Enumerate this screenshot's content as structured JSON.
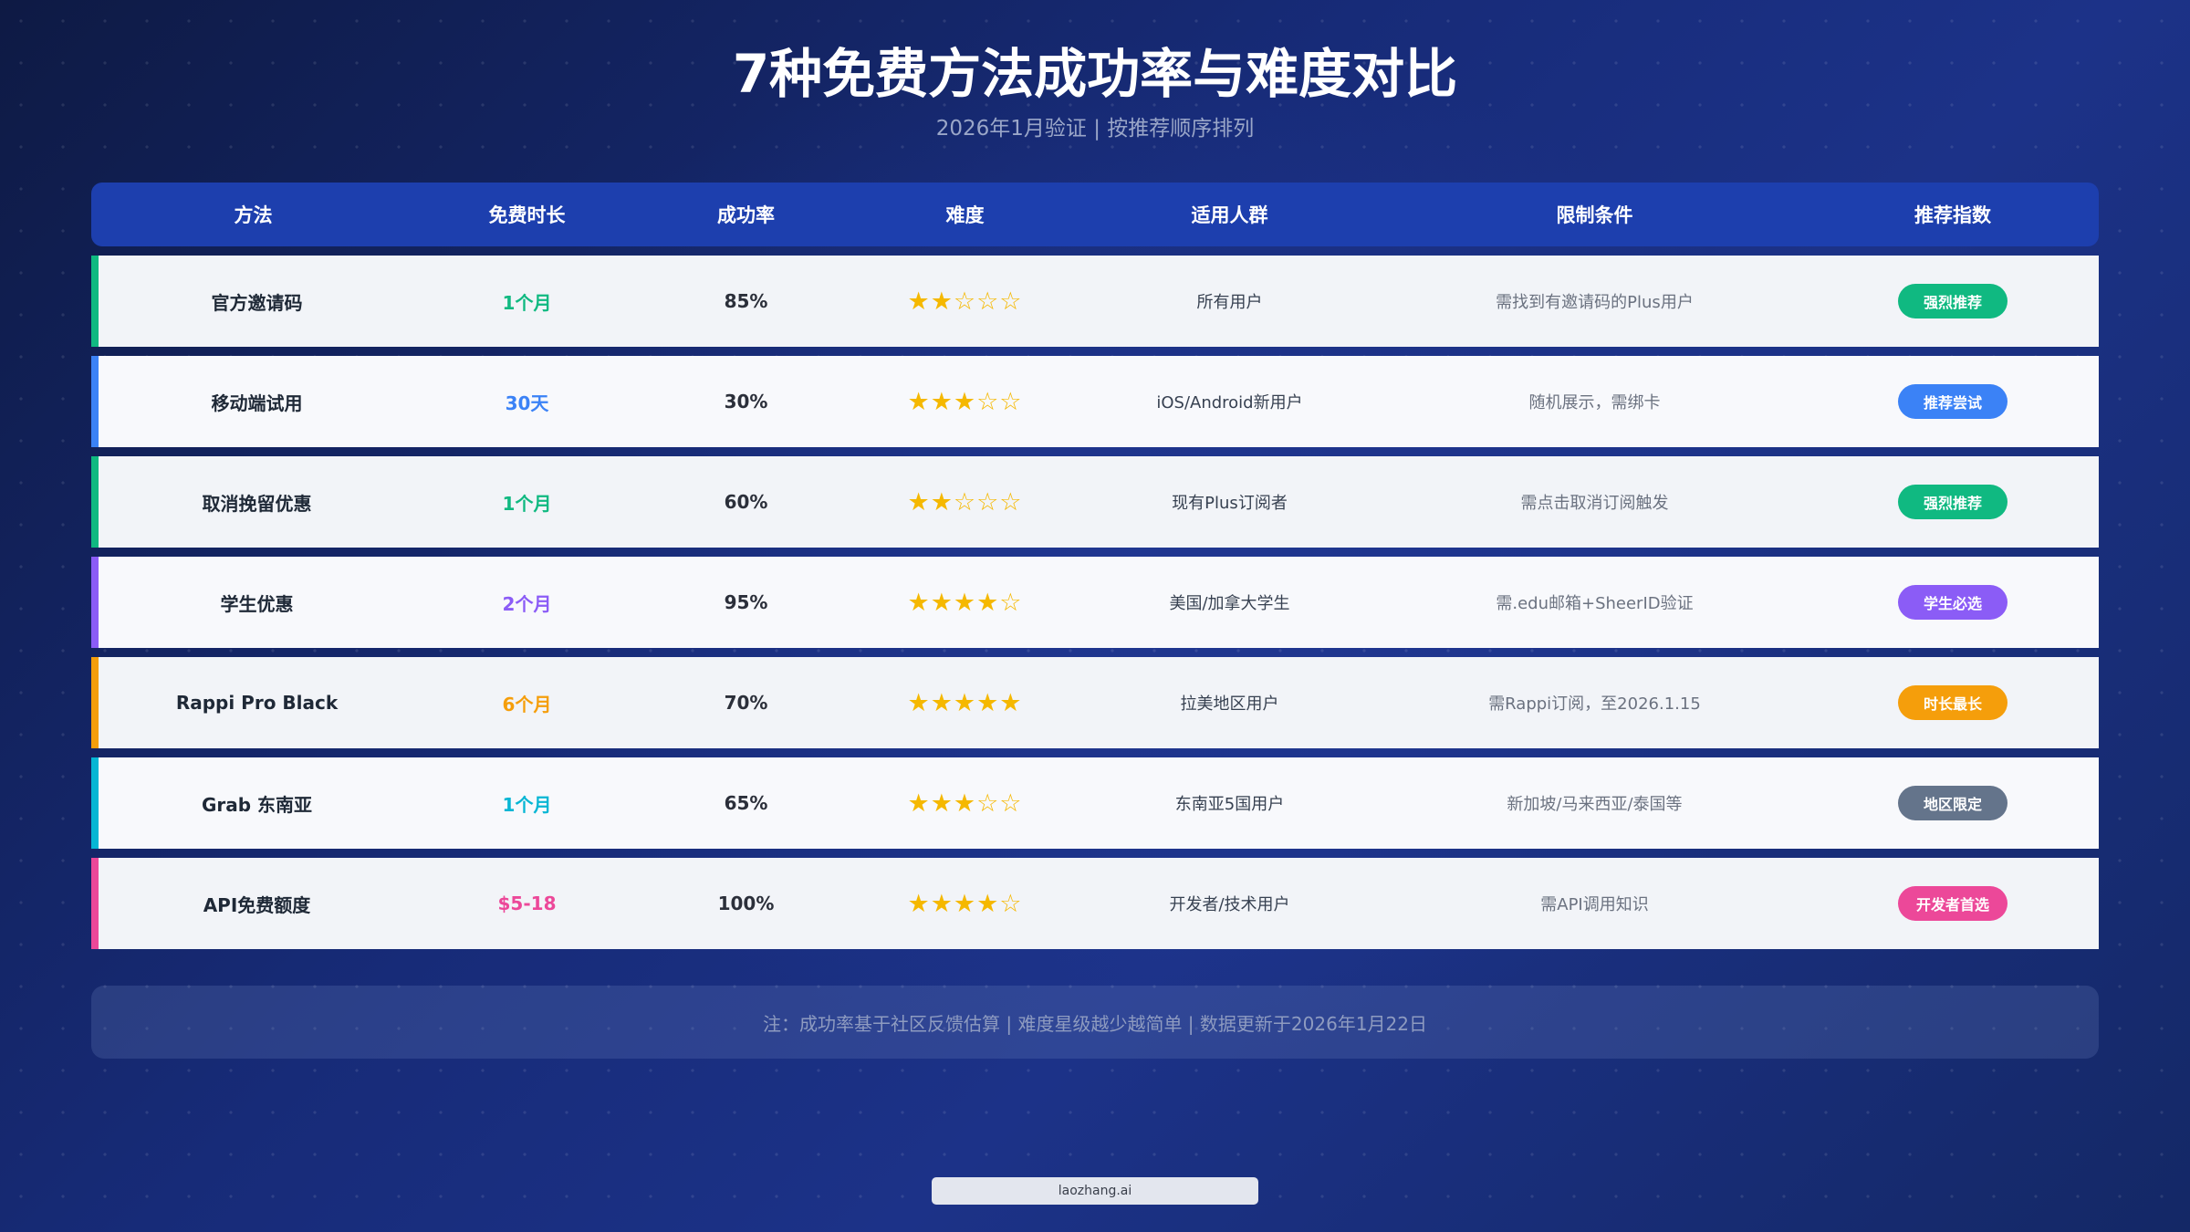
{
  "page": {
    "title": "7种免费方法成功率与难度对比",
    "subtitle": "2026年1月验证 | 按推荐顺序排列"
  },
  "table": {
    "headers": [
      "方法",
      "免费时长",
      "成功率",
      "难度",
      "适用人群",
      "限制条件",
      "推荐指数"
    ],
    "rows": [
      {
        "method": "官方邀请码",
        "duration": "1个月",
        "duration_color": "#10b981",
        "success_rate": "85%",
        "difficulty_stars": 2,
        "stars_text": "★★☆☆☆",
        "audience": "所有用户",
        "limit": "需找到有邀请码的Plus用户",
        "badge": "强烈推荐",
        "badge_color": "#10b981",
        "accent_color": "#10b981"
      },
      {
        "method": "移动端试用",
        "duration": "30天",
        "duration_color": "#3b82f6",
        "success_rate": "30%",
        "difficulty_stars": 3,
        "stars_text": "★★★☆☆",
        "audience": "iOS/Android新用户",
        "limit": "随机展示，需绑卡",
        "badge": "推荐尝试",
        "badge_color": "#3b82f6",
        "accent_color": "#3b82f6"
      },
      {
        "method": "取消挽留优惠",
        "duration": "1个月",
        "duration_color": "#10b981",
        "success_rate": "60%",
        "difficulty_stars": 2,
        "stars_text": "★★☆☆☆",
        "audience": "现有Plus订阅者",
        "limit": "需点击取消订阅触发",
        "badge": "强烈推荐",
        "badge_color": "#10b981",
        "accent_color": "#10b981"
      },
      {
        "method": "学生优惠",
        "duration": "2个月",
        "duration_color": "#8b5cf6",
        "success_rate": "95%",
        "difficulty_stars": 4,
        "stars_text": "★★★★☆",
        "audience": "美国/加拿大学生",
        "limit": "需.edu邮箱+SheerID验证",
        "badge": "学生必选",
        "badge_color": "#8b5cf6",
        "accent_color": "#8b5cf6"
      },
      {
        "method": "Rappi Pro Black",
        "duration": "6个月",
        "duration_color": "#f59e0b",
        "success_rate": "70%",
        "difficulty_stars": 5,
        "stars_text": "★★★★★",
        "audience": "拉美地区用户",
        "limit": "需Rappi订阅，至2026.1.15",
        "badge": "时长最长",
        "badge_color": "#f59e0b",
        "accent_color": "#f59e0b"
      },
      {
        "method": "Grab 东南亚",
        "duration": "1个月",
        "duration_color": "#06b6d4",
        "success_rate": "65%",
        "difficulty_stars": 3,
        "stars_text": "★★★☆☆",
        "audience": "东南亚5国用户",
        "limit": "新加坡/马来西亚/泰国等",
        "badge": "地区限定",
        "badge_color": "#64748b",
        "accent_color": "#06b6d4"
      },
      {
        "method": "API免费额度",
        "duration": "$5-18",
        "duration_color": "#ec4899",
        "success_rate": "100%",
        "difficulty_stars": 4,
        "stars_text": "★★★★☆",
        "audience": "开发者/技术用户",
        "limit": "需API调用知识",
        "badge": "开发者首选",
        "badge_color": "#ec4899",
        "accent_color": "#ec4899"
      }
    ]
  },
  "footer": {
    "note": "注：成功率基于社区反馈估算 | 难度星级越少越简单 | 数据更新于2026年1月22日",
    "watermark": "laozhang.ai"
  }
}
